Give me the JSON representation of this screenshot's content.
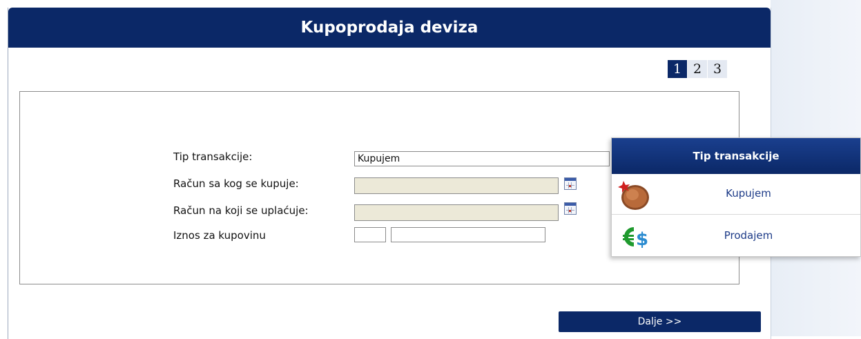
{
  "window": {
    "title": "Kupoprodaja deviza"
  },
  "steps": [
    "1",
    "2",
    "3"
  ],
  "active_step": "1",
  "form": {
    "transaction_type": {
      "label": "Tip transakcije:",
      "value": "Kupujem"
    },
    "debit_account": {
      "label": "Račun sa kog se kupuje:",
      "value": ""
    },
    "credit_account": {
      "label": "Račun na koji se uplaćuje:",
      "value": ""
    },
    "amount": {
      "label": "Iznos za kupovinu",
      "currency_value": "",
      "amount_value": ""
    }
  },
  "dropdown": {
    "title": "Tip transakcije",
    "options": [
      {
        "label": "Kupujem",
        "icon": "coin-icon"
      },
      {
        "label": "Prodajem",
        "icon": "money-icon"
      }
    ]
  },
  "buttons": {
    "next_label": "Dalje >>"
  },
  "colors": {
    "brand_navy": "#0b2867",
    "disabled_field": "#ece9d8",
    "link_blue": "#1c3a87"
  }
}
